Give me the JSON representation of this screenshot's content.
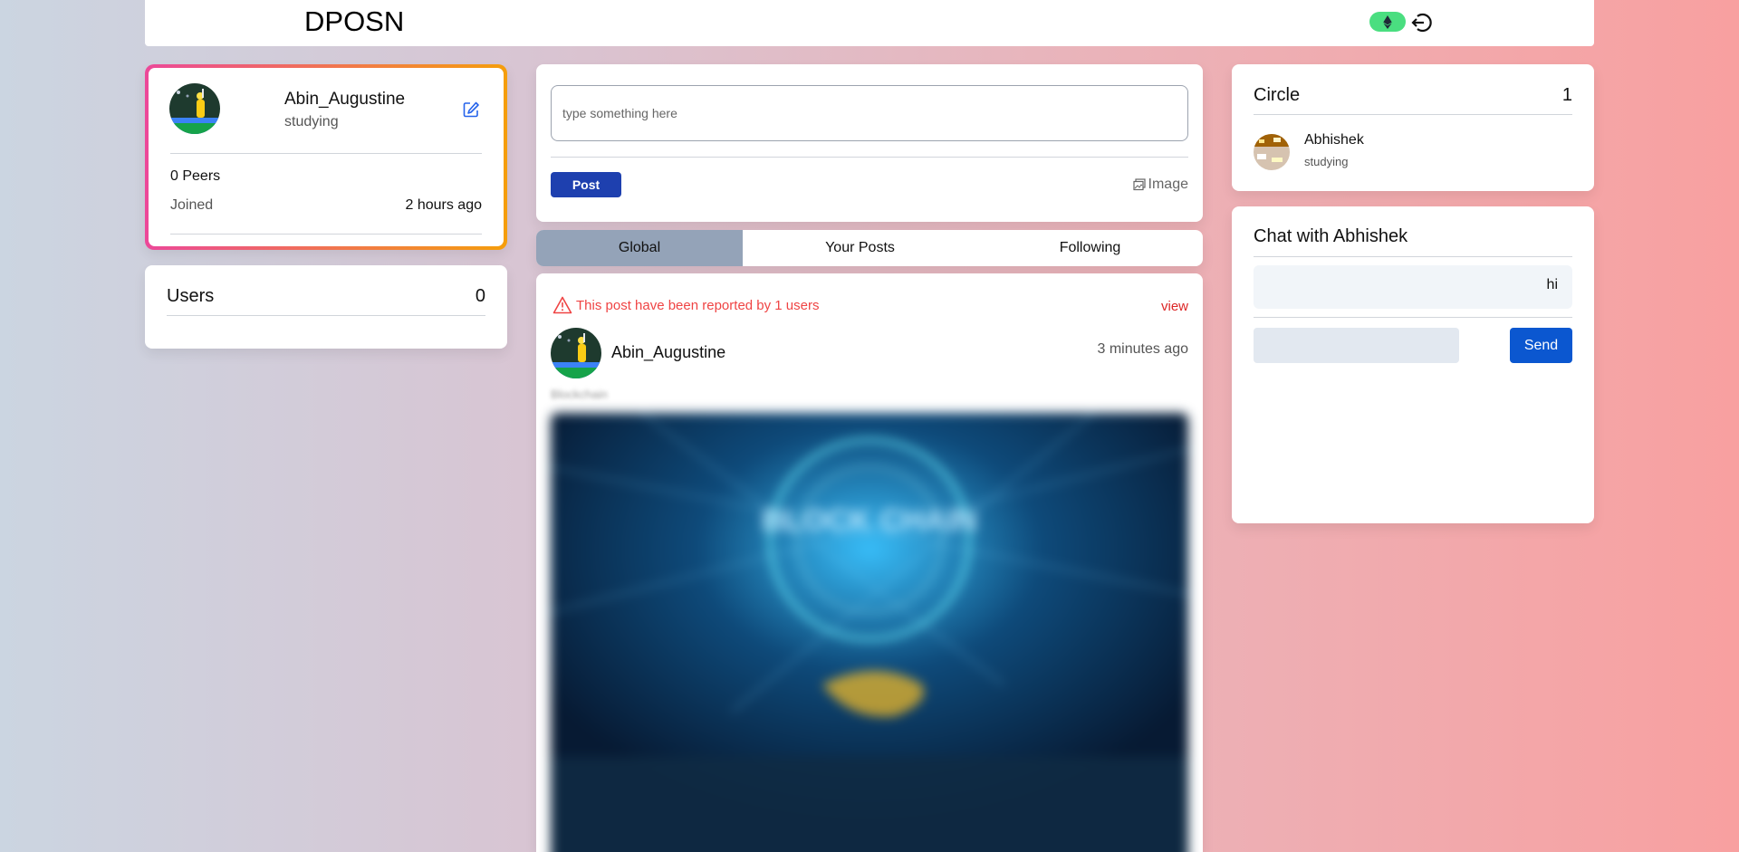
{
  "header": {
    "brand": "DPOSN",
    "wallet_icon": "ethereum-icon",
    "logout_icon": "logout-icon",
    "accent": "#4ade80"
  },
  "profile": {
    "name": "Abin_Augustine",
    "status": "studying",
    "peers": "0 Peers",
    "joined_label": "Joined",
    "joined_value": "2 hours ago",
    "edit_icon": "edit-icon"
  },
  "users": {
    "title": "Users",
    "count": "0"
  },
  "composer": {
    "placeholder": "type something here",
    "post_label": "Post",
    "image_label": "Image",
    "post_color": "#1e40af"
  },
  "tabs": [
    {
      "label": "Global",
      "active": true
    },
    {
      "label": "Your Posts",
      "active": false
    },
    {
      "label": "Following",
      "active": false
    }
  ],
  "feed": {
    "report_text": "This post have been reported by 1 users",
    "view_label": "view",
    "author": "Abin_Augustine",
    "time": "3 minutes ago",
    "caption": "Blockchain",
    "image_text": "BLOCK CHAIN",
    "report_color": "#ef4444"
  },
  "circle": {
    "title": "Circle",
    "count": "1",
    "member_name": "Abhishek",
    "member_status": "studying"
  },
  "chat": {
    "title": "Chat with Abhishek",
    "message": "hi",
    "input_value": "",
    "send_label": "Send",
    "send_color": "#0b57d0"
  }
}
